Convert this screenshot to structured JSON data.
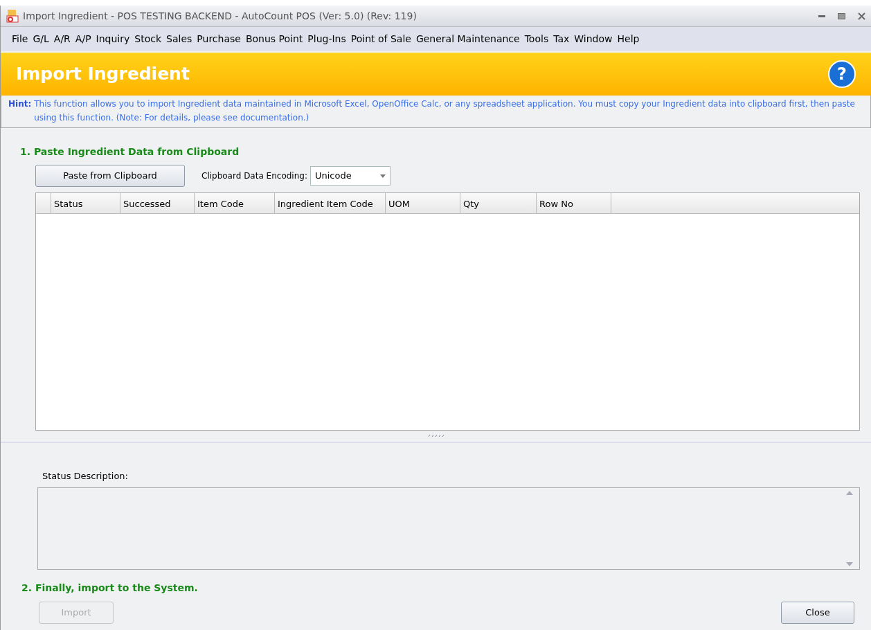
{
  "window": {
    "title": "Import Ingredient - POS TESTING BACKEND - AutoCount POS (Ver: 5.0) (Rev: 119)"
  },
  "menu": [
    "File",
    "G/L",
    "A/R",
    "A/P",
    "Inquiry",
    "Stock",
    "Sales",
    "Purchase",
    "Bonus Point",
    "Plug-Ins",
    "Point of Sale",
    "General Maintenance",
    "Tools",
    "Tax",
    "Window",
    "Help"
  ],
  "header": {
    "title": "Import Ingredient",
    "help": "?"
  },
  "hint": {
    "label": "Hint:",
    "text": "This function allows you to import Ingredient data maintained in Microsoft Excel, OpenOffice Calc, or any spreadsheet application. You must copy your Ingredient data into clipboard first, then paste using this function. (Note: For details, please see documentation.)"
  },
  "step1": {
    "title": "1. Paste Ingredient Data from Clipboard",
    "paste_button": "Paste from Clipboard",
    "encoding_label": "Clipboard Data Encoding:",
    "encoding_value": "Unicode"
  },
  "table": {
    "columns": [
      "Status",
      "Successed",
      "Item Code",
      "Ingredient Item Code",
      "UOM",
      "Qty",
      "Row No"
    ]
  },
  "status_description": {
    "label": "Status Description:"
  },
  "step2": {
    "title": "2. Finally, import to the System.",
    "import_button": {
      "label": "Import",
      "disabled": true
    },
    "close_button": {
      "label": "Close",
      "disabled": false
    }
  }
}
